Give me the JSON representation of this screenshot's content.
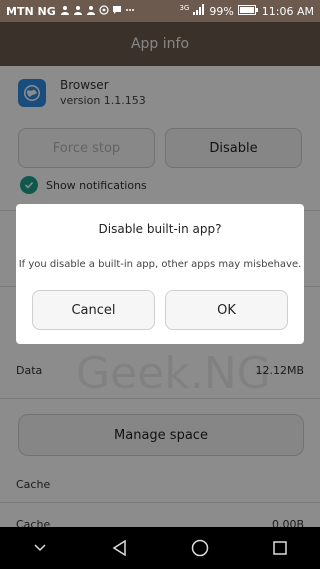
{
  "status_bar": {
    "carrier": "MTN NG",
    "network_type": "3G",
    "battery": "99%",
    "time": "11:06 AM"
  },
  "header": {
    "title": "App info"
  },
  "app": {
    "name": "Browser",
    "version": "version 1.1.153"
  },
  "buttons": {
    "force_stop": "Force stop",
    "disable": "Disable"
  },
  "notifications": {
    "label": "Show notifications",
    "checked": true
  },
  "storage": {
    "data_label": "Data",
    "data_value": "12.12MB",
    "manage_space": "Manage space",
    "cache_section": "Cache",
    "cache_label": "Cache",
    "cache_value": "0.00B"
  },
  "watermark": "Geek.NG",
  "dialog": {
    "title": "Disable built-in app?",
    "message": "If you disable a built-in app, other apps may misbehave.",
    "cancel": "Cancel",
    "ok": "OK"
  },
  "colors": {
    "header_bg": "#6b5a4d",
    "check_teal": "#1aa38a",
    "app_icon_blue": "#2f8de4"
  }
}
